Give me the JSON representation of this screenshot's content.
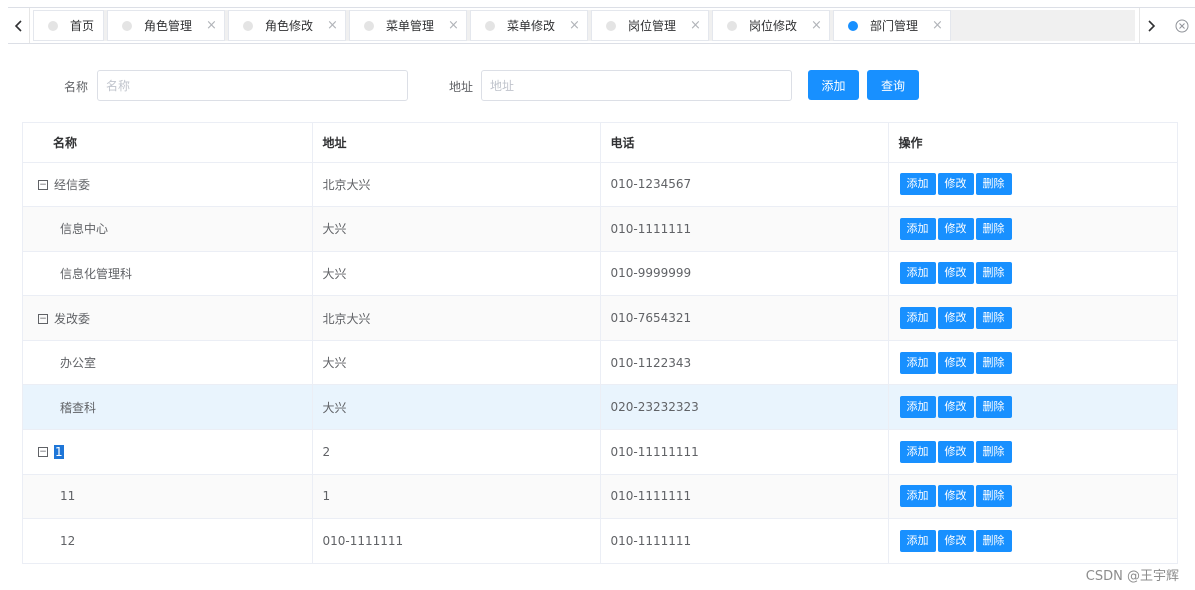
{
  "tabs": [
    {
      "label": "首页",
      "closable": false,
      "active": false
    },
    {
      "label": "角色管理",
      "closable": true,
      "active": false
    },
    {
      "label": "角色修改",
      "closable": true,
      "active": false
    },
    {
      "label": "菜单管理",
      "closable": true,
      "active": false
    },
    {
      "label": "菜单修改",
      "closable": true,
      "active": false
    },
    {
      "label": "岗位管理",
      "closable": true,
      "active": false
    },
    {
      "label": "岗位修改",
      "closable": true,
      "active": false
    },
    {
      "label": "部门管理",
      "closable": true,
      "active": true
    }
  ],
  "tab_close_glyph": "×",
  "tabbar": {
    "prev_icon": "‹",
    "next_icon": "›",
    "close_all_icon": "⊗"
  },
  "search": {
    "name_label": "名称",
    "name_placeholder": "名称",
    "name_value": "",
    "address_label": "地址",
    "address_placeholder": "地址",
    "address_value": "",
    "add_button": "添加",
    "query_button": "查询"
  },
  "table": {
    "headers": {
      "name": "名称",
      "address": "地址",
      "phone": "电话",
      "ops": "操作"
    },
    "ops_labels": {
      "add": "添加",
      "edit": "修改",
      "delete": "删除"
    },
    "expand_glyph": "−",
    "rows": [
      {
        "name": "经信委",
        "address": "北京大兴",
        "phone": "010-1234567"
      },
      {
        "name": "信息中心",
        "address": "大兴",
        "phone": "010-1111111"
      },
      {
        "name": "信息化管理科",
        "address": "大兴",
        "phone": "010-9999999"
      },
      {
        "name": "发改委",
        "address": "北京大兴",
        "phone": "010-7654321"
      },
      {
        "name": "办公室",
        "address": "大兴",
        "phone": "010-1122343"
      },
      {
        "name": "稽查科",
        "address": "大兴",
        "phone": "020-23232323"
      },
      {
        "name": "1",
        "address": "2",
        "phone": "010-11111111"
      },
      {
        "name": "11",
        "address": "1",
        "phone": "010-1111111"
      },
      {
        "name": "12",
        "address": "010-1111111",
        "phone": "010-1111111"
      }
    ]
  },
  "colors": {
    "primary": "#1890ff",
    "highlight_row": "#e9f4fd"
  },
  "watermark": "CSDN @王宇辉"
}
